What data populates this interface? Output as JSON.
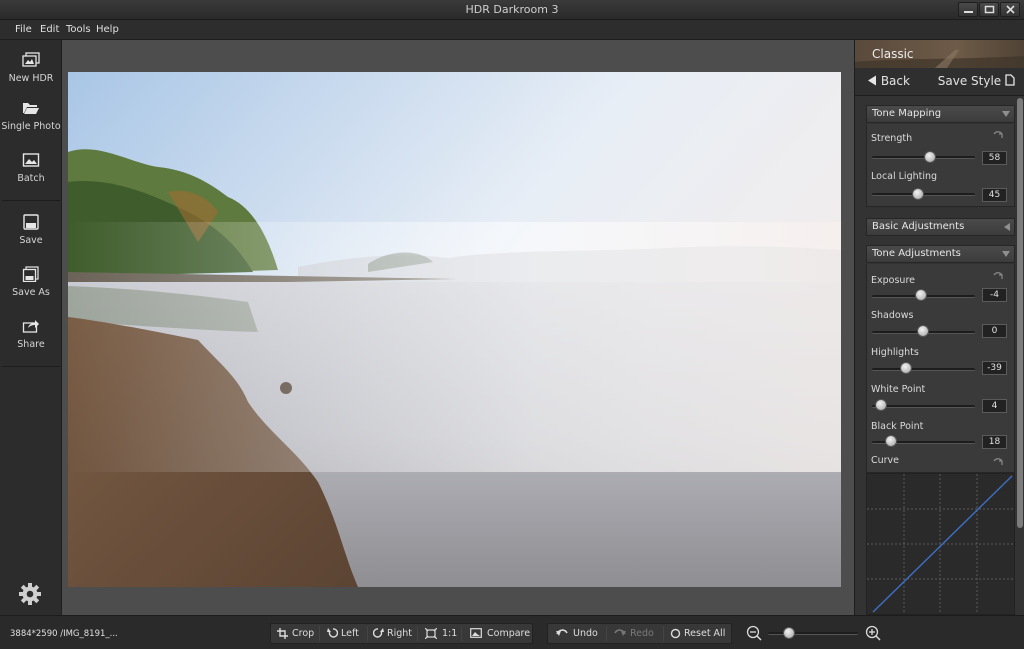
{
  "window": {
    "title": "HDR Darkroom 3"
  },
  "menu": {
    "file": "File",
    "edit": "Edit",
    "tools": "Tools",
    "help": "Help"
  },
  "left_toolbar": {
    "new_hdr": "New HDR",
    "single_photo": "Single Photo",
    "batch": "Batch",
    "save": "Save",
    "save_as": "Save As",
    "share": "Share"
  },
  "panel": {
    "style_name": "Classic",
    "back": "Back",
    "save_style": "Save Style",
    "tone_mapping": {
      "title": "Tone Mapping",
      "strength": {
        "label": "Strength",
        "value": "58"
      },
      "local_lighting": {
        "label": "Local Lighting",
        "value": "45"
      }
    },
    "basic_adjustments": {
      "title": "Basic Adjustments"
    },
    "tone_adjustments": {
      "title": "Tone Adjustments",
      "exposure": {
        "label": "Exposure",
        "value": "-4"
      },
      "shadows": {
        "label": "Shadows",
        "value": "0"
      },
      "highlights": {
        "label": "Highlights",
        "value": "-39"
      },
      "white_point": {
        "label": "White Point",
        "value": "4"
      },
      "black_point": {
        "label": "Black Point",
        "value": "18"
      },
      "curve": {
        "label": "Curve"
      }
    }
  },
  "bottom": {
    "status": "3884*2590 /IMG_8191_...",
    "crop": "Crop",
    "left": "Left",
    "right": "Right",
    "one_to_one": "1:1",
    "compare": "Compare",
    "undo": "Undo",
    "redo": "Redo",
    "reset_all": "Reset All"
  },
  "colors": {
    "accent_curve": "#3d6fc4",
    "background": "#2e2e2e",
    "canvas": "#4d4d4d"
  },
  "icons": {
    "new_hdr": "images-stack-icon",
    "single_photo": "folder-open-icon",
    "batch": "image-icon",
    "save": "floppy-disk-icon",
    "save_as": "floppy-stack-icon",
    "share": "share-arrow-icon",
    "settings": "gear-icon",
    "back": "triangle-left-icon",
    "save_style": "document-icon"
  }
}
